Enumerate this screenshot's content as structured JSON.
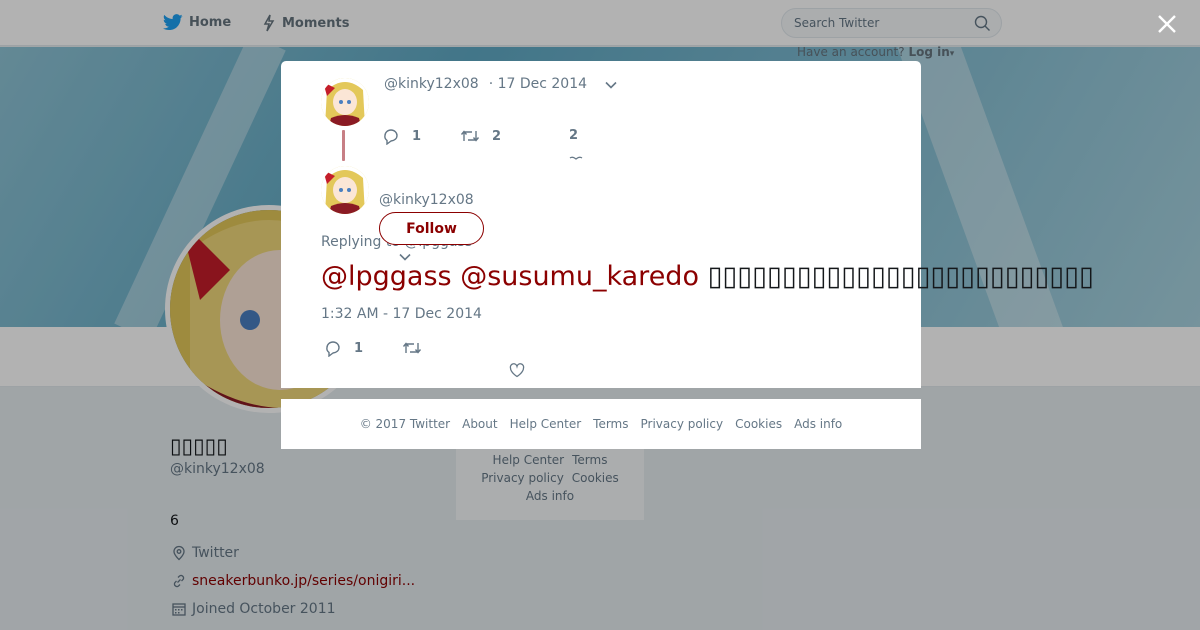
{
  "nav": {
    "home_label": "Home",
    "moments_label": "Moments",
    "search_placeholder": "Search Twitter",
    "account_prompt": "Have an account?",
    "login_label": "Log in"
  },
  "profile": {
    "name": "▯▯▯▯▯",
    "handle": "@kinky12x08",
    "count": "6",
    "location": "Twitter",
    "website": "sneakerbunko.jp/series/onigiri...",
    "joined": "Joined October 2011"
  },
  "background_footer": {
    "line1": [
      "Help Center",
      "Terms"
    ],
    "line2": [
      "Privacy policy",
      "Cookies"
    ],
    "line3": [
      "Ads info"
    ]
  },
  "modal": {
    "parent_tweet": {
      "handle": "@kinky12x08",
      "date": "· 17 Dec 2014",
      "reply_count": "1",
      "retweet_count": "2",
      "like_count": "2"
    },
    "main_tweet": {
      "handle": "@kinky12x08",
      "follow_label": "Follow",
      "replying_label": "Replying to",
      "replying_to": "@lpggass",
      "mention1": "@lpggass",
      "mention2": "@susumu_karedo",
      "body": "▯▯▯▯▯▯▯▯▯▯▯▯▯▯▯▯▯▯▯▯▯▯▯▯▯▯",
      "timestamp": "1:32 AM - 17 Dec 2014",
      "reply_count": "1"
    }
  },
  "modal_footer": {
    "copyright": "© 2017 Twitter",
    "about": "About",
    "help": "Help Center",
    "terms": "Terms",
    "privacy": "Privacy policy",
    "cookies": "Cookies",
    "ads": "Ads info"
  },
  "colors": {
    "accent": "#8b0000",
    "twitter_blue": "#1da1f2",
    "thread_line": "#c77f85"
  }
}
